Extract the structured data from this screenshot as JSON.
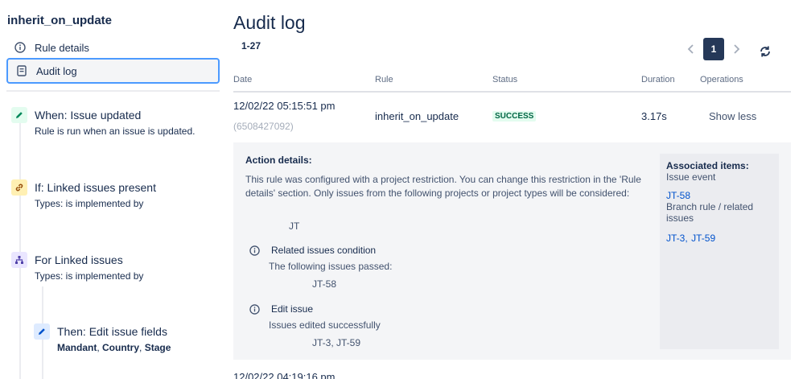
{
  "sidebar": {
    "rule_name": "inherit_on_update",
    "nav": [
      {
        "label": "Rule details",
        "icon": "info-icon",
        "active": false
      },
      {
        "label": "Audit log",
        "icon": "document-icon",
        "active": true
      }
    ],
    "steps": [
      {
        "title": "When: Issue updated",
        "subtitle": "Rule is run when an issue is updated.",
        "icon": "pencil-icon"
      },
      {
        "title": "If: Linked issues present",
        "subtitle": "Types: is implemented by",
        "icon": "link-icon"
      },
      {
        "title": "For Linked issues",
        "subtitle": "Types: is implemented by",
        "icon": "hierarchy-icon"
      },
      {
        "title": "Then: Edit issue fields",
        "subtitle": "Mandant, Country, Stage",
        "icon": "pencil-icon"
      }
    ]
  },
  "main": {
    "title": "Audit log",
    "range": "1-27",
    "pager": {
      "current_page": "1"
    },
    "columns": [
      "Date",
      "Rule",
      "Status",
      "Duration",
      "Operations"
    ],
    "rows": [
      {
        "date": "12/02/22 05:15:51 pm",
        "id": "(6508427092)",
        "rule": "inherit_on_update",
        "status": "SUCCESS",
        "duration": "3.17s",
        "operation": "Show less"
      }
    ],
    "details": {
      "title": "Action details:",
      "restriction_text": "This rule was configured with a project restriction. You can change this restriction in the 'Rule details' section. Only issues from the following projects or project types will be considered:",
      "project": "JT",
      "items": [
        {
          "title": "Related issues condition",
          "subtitle": "The following issues passed:",
          "value": "JT-58"
        },
        {
          "title": "Edit issue",
          "subtitle": "Issues edited successfully",
          "value": "JT-3, JT-59"
        }
      ],
      "associated": {
        "title": "Associated items:",
        "event_label": "Issue event",
        "event_link": "JT-58",
        "branch_label": "Branch rule / related issues",
        "branch_link_1": "JT-3,",
        "branch_link_2": "JT-59"
      }
    },
    "next_row_date": "12/02/22 04:19:16 pm"
  }
}
